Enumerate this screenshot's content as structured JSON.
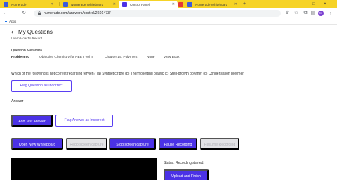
{
  "browser": {
    "tabs": [
      {
        "title": "Numerade",
        "favicon_color": "#3b5bdb",
        "active": false
      },
      {
        "title": "Numerade Whiteboard",
        "favicon_color": "#3b5bdb",
        "active": false
      },
      {
        "title": "Control Panel",
        "favicon_color": "#4b32e6",
        "active": true
      },
      {
        "title": "",
        "favicon_color": "#e53935",
        "active": false
      },
      {
        "title": "Numerade Whiteboard",
        "favicon_color": "#3b5bdb",
        "active": false
      }
    ],
    "url": "numerade.com/answers/control/2601473/",
    "bookmarks_label": "Apps",
    "profile_initial": "M"
  },
  "page": {
    "title": "My Questions",
    "learn_link": "Learn How To Record",
    "metadata_heading": "Question Metadata",
    "metadata": {
      "problem": "Problem 50",
      "book": "Objective Chemistry for NEET Vol II",
      "chapter": "Chapter 15: Polymers",
      "section": "None",
      "view_book": "View Book"
    },
    "question_text": "Which of the following is not correct regarding terylen? (a) Synthetic fibre (b) Thermosetting plastic (c) Step-growth polymer (d) Condensation polymer",
    "flag_question_label": "Flag Question as Incorrect",
    "answer_label": "Answer",
    "add_test_answer_label": "Add Test Answer",
    "flag_answer_label": "Flag Answer as Incorrect",
    "controls": {
      "open_whiteboard": "Open New Whiteboard",
      "redo_capture": "Redo screen capture",
      "stop_capture": "Stop screen capture",
      "pause_recording": "Pause Recording",
      "resume_recording": "Resume Recording"
    },
    "status_text": "Status: Recording started.",
    "upload_finish_label": "Upload and Finish"
  }
}
